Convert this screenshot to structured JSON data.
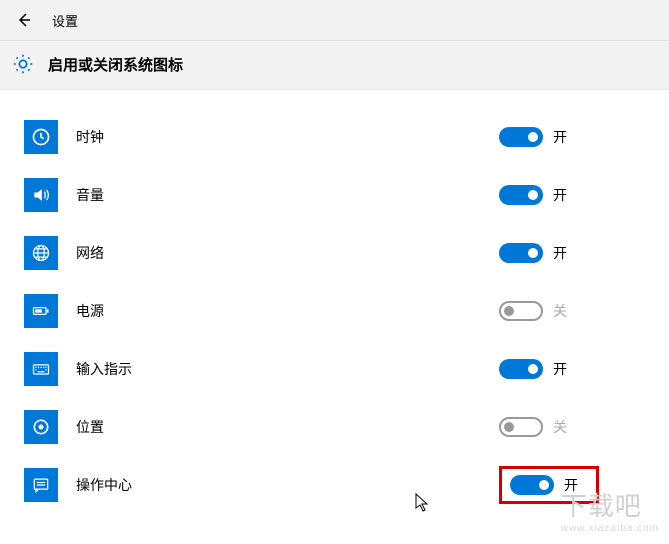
{
  "header": {
    "title": "设置"
  },
  "page": {
    "title": "启用或关闭系统图标"
  },
  "toggleLabels": {
    "on": "开",
    "off": "关"
  },
  "items": [
    {
      "id": "clock",
      "label": "时钟",
      "enabled": true
    },
    {
      "id": "volume",
      "label": "音量",
      "enabled": true
    },
    {
      "id": "network",
      "label": "网络",
      "enabled": true
    },
    {
      "id": "power",
      "label": "电源",
      "enabled": false
    },
    {
      "id": "input",
      "label": "输入指示",
      "enabled": true
    },
    {
      "id": "location",
      "label": "位置",
      "enabled": false
    },
    {
      "id": "action-center",
      "label": "操作中心",
      "enabled": true,
      "highlight": true
    }
  ],
  "watermark": {
    "main": "下载吧",
    "sub": "www.xiazaiba.com"
  }
}
